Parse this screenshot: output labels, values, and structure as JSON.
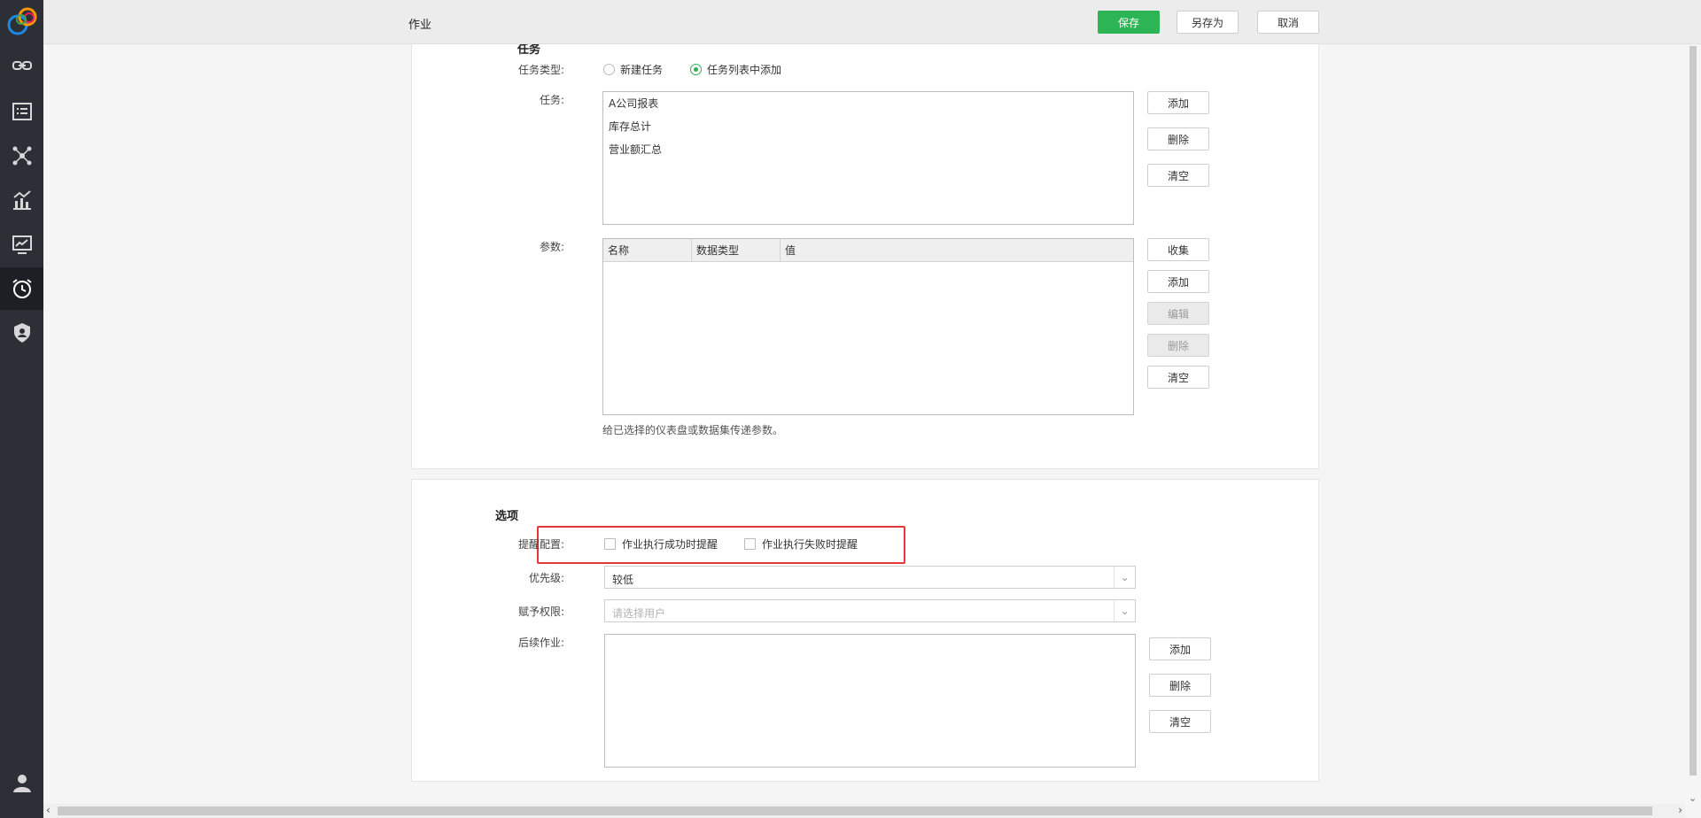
{
  "header": {
    "title": "作业",
    "save_label": "保存",
    "save_as_label": "另存为",
    "cancel_label": "取消"
  },
  "task_section": {
    "title": "任务",
    "task_type_label": "任务类型:",
    "type_options": [
      "新建任务",
      "任务列表中添加"
    ],
    "selected_type": "任务列表中添加",
    "tasks_label": "任务:",
    "tasks": [
      "A公司报表",
      "库存总计",
      "营业额汇总"
    ],
    "task_buttons": {
      "add": "添加",
      "delete": "删除",
      "clear": "清空"
    },
    "params_label": "参数:",
    "params_columns": [
      "名称",
      "数据类型",
      "值"
    ],
    "params_buttons": {
      "collect": "收集",
      "add": "添加",
      "edit": "编辑",
      "delete": "删除",
      "clear": "清空"
    },
    "params_hint": "给已选择的仪表盘或数据集传递参数。"
  },
  "options_section": {
    "title": "选项",
    "reminder_label": "提醒配置:",
    "reminder_success": "作业执行成功时提醒",
    "reminder_failure": "作业执行失败时提醒",
    "priority_label": "优先级:",
    "priority_value": "较低",
    "permission_label": "赋予权限:",
    "permission_placeholder": "请选择用户",
    "followup_label": "后续作业:",
    "followup_buttons": {
      "add": "添加",
      "delete": "删除",
      "clear": "清空"
    }
  },
  "colors": {
    "accent": "#2db455",
    "highlight": "#e53935",
    "sidebar": "#2c2f36"
  }
}
